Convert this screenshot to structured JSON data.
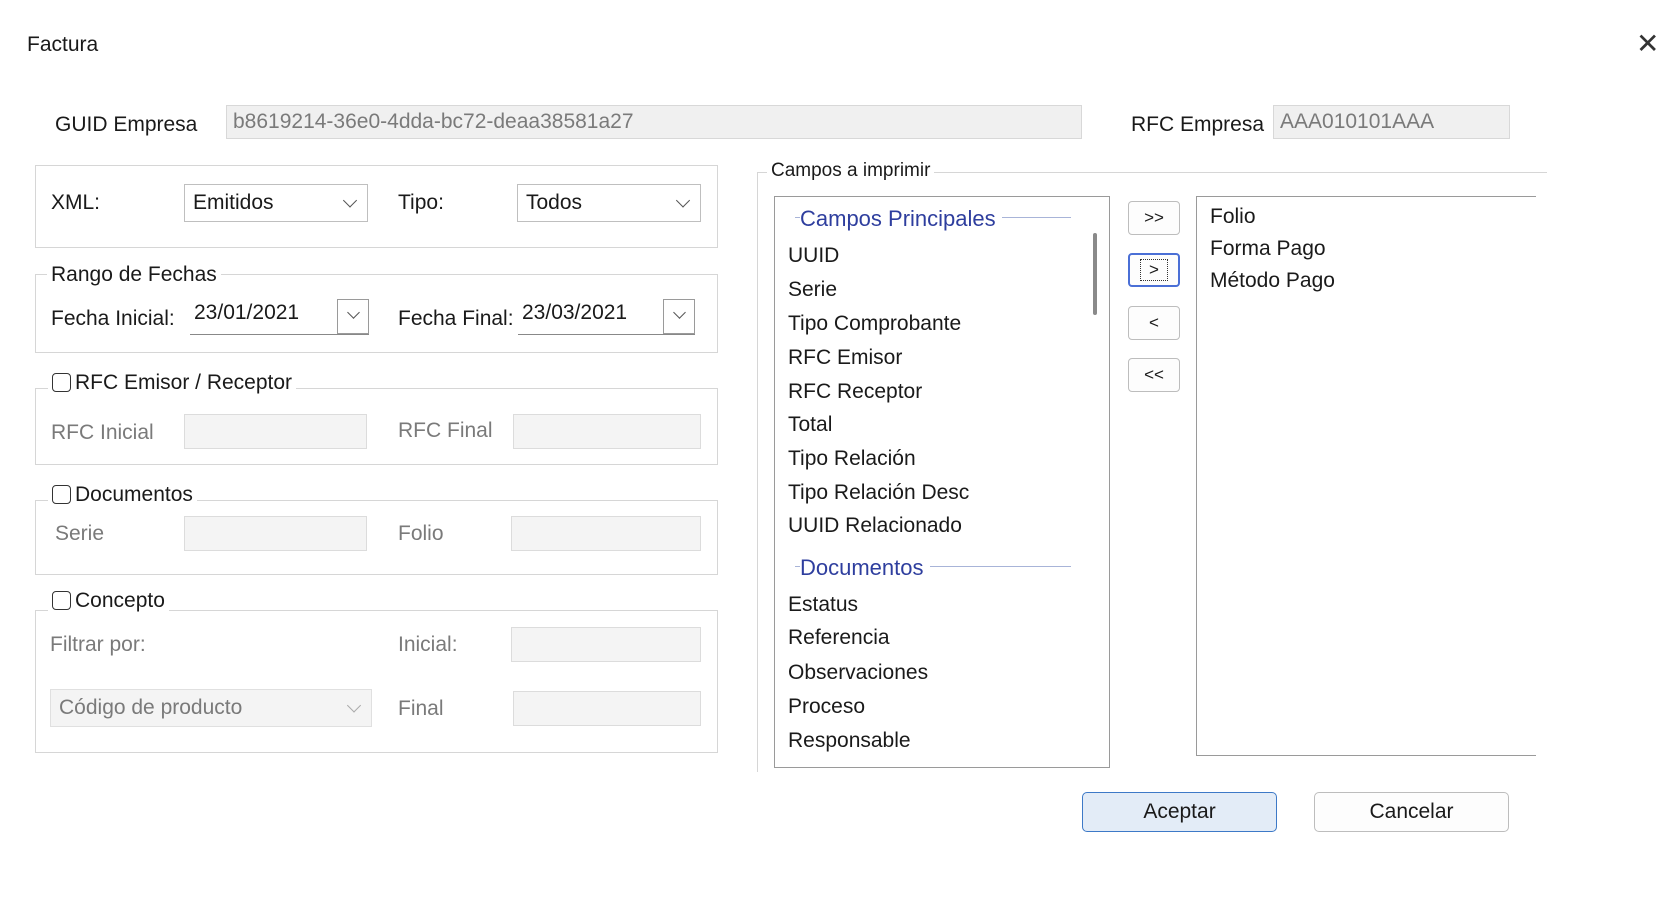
{
  "window": {
    "title": "Factura",
    "close_symbol": "✕"
  },
  "guid": {
    "label": "GUID Empresa",
    "value": "b8619214-36e0-4dda-bc72-deaa38581a27"
  },
  "rfc_empresa": {
    "label": "RFC Empresa",
    "value": "AAA010101AAA"
  },
  "xml": {
    "label": "XML:",
    "value": "Emitidos"
  },
  "tipo": {
    "label": "Tipo:",
    "value": "Todos"
  },
  "fechas": {
    "group_label": "Rango de Fechas",
    "inicial_label": "Fecha Inicial:",
    "inicial_value": "23/01/2021",
    "final_label": "Fecha Final:",
    "final_value": "23/03/2021"
  },
  "rfc_filter": {
    "group_label": "RFC Emisor / Receptor",
    "checked": false,
    "inicial_label": "RFC Inicial",
    "final_label": "RFC Final"
  },
  "documentos": {
    "group_label": "Documentos",
    "checked": false,
    "serie_label": "Serie",
    "folio_label": "Folio"
  },
  "concepto": {
    "group_label": "Concepto",
    "checked": false,
    "filtrar_label": "Filtrar por:",
    "filtrar_value": "Código de producto",
    "inicial_label": "Inicial:",
    "final_label": "Final"
  },
  "campos": {
    "group_label": "Campos a imprimir",
    "available_groups": [
      {
        "header": "Campos Principales",
        "items": [
          "UUID",
          "Serie",
          "Tipo Comprobante",
          "RFC Emisor",
          "RFC Receptor",
          "Total",
          "Tipo Relación",
          "Tipo Relación Desc",
          "UUID Relacionado"
        ]
      },
      {
        "header": "Documentos",
        "items": [
          "Estatus",
          "Referencia",
          "Observaciones",
          "Proceso",
          "Responsable"
        ]
      }
    ],
    "selected": [
      "Folio",
      "Forma Pago",
      "Método Pago"
    ],
    "buttons": {
      "add_all": ">>",
      "add": ">",
      "remove": "<",
      "remove_all": "<<"
    }
  },
  "actions": {
    "accept": "Aceptar",
    "cancel": "Cancelar"
  }
}
